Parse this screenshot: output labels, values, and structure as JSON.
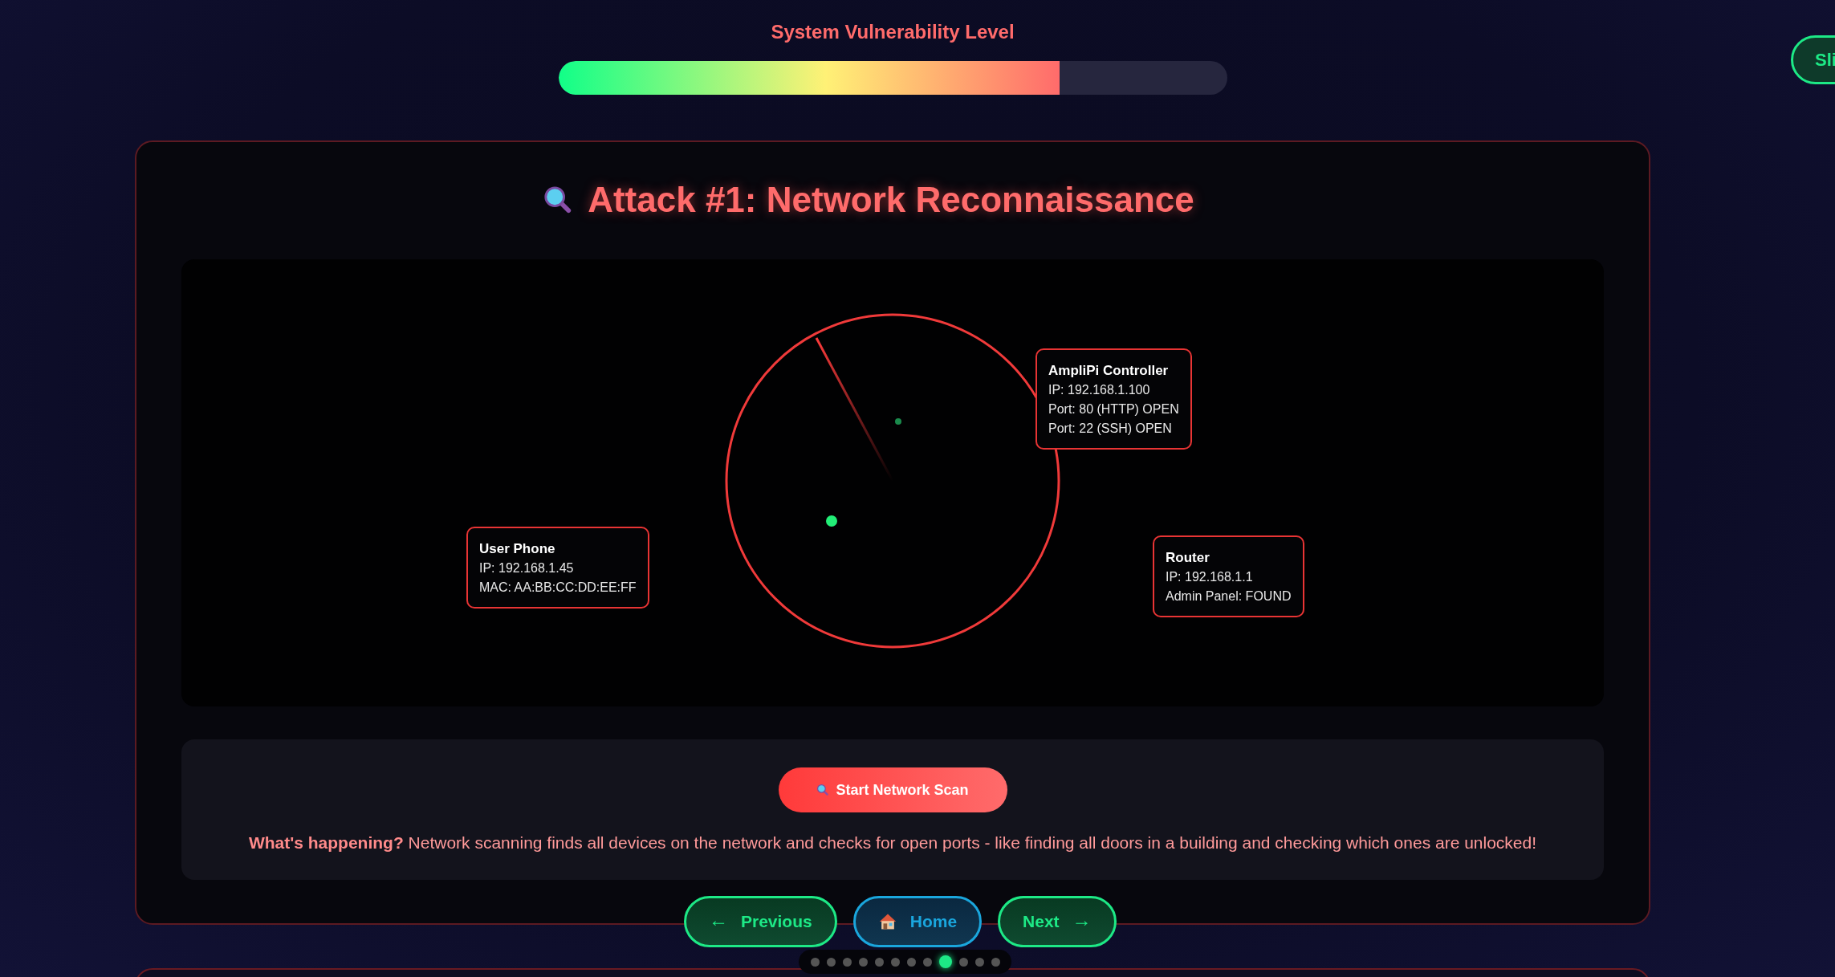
{
  "vulnerability": {
    "title": "System Vulnerability Level",
    "level": 0.75
  },
  "side_button": {
    "label": "Sli"
  },
  "attack": {
    "title": "Attack #1: Network Reconnaissance",
    "devices": [
      {
        "name": "AmpliPi Controller",
        "lines": [
          "IP: 192.168.1.100",
          "Port: 80 (HTTP) OPEN",
          "Port: 22 (SSH) OPEN"
        ]
      },
      {
        "name": "User Phone",
        "lines": [
          "IP: 192.168.1.45",
          "MAC: AA:BB:CC:DD:EE:FF"
        ]
      },
      {
        "name": "Router",
        "lines": [
          "IP: 192.168.1.1",
          "Admin Panel: FOUND"
        ]
      }
    ],
    "scan_button": {
      "label": "Start Network Scan"
    },
    "explanation": "**What's happening?** Network scanning finds all devices on the network and checks for open ports - like finding all doors in a building and checking which ones are unlocked!"
  },
  "nav": [
    {
      "kind": "previous",
      "label": "Previous",
      "arrow": "←"
    },
    {
      "kind": "home",
      "label": "Home"
    },
    {
      "kind": "next",
      "label": "Next",
      "arrow": "→"
    }
  ],
  "slides": [
    {
      "selected": false
    },
    {
      "selected": false
    },
    {
      "selected": false
    },
    {
      "selected": false
    },
    {
      "selected": false
    },
    {
      "selected": false
    },
    {
      "selected": false
    },
    {
      "selected": false
    },
    {
      "selected": true
    },
    {
      "selected": false
    },
    {
      "selected": false
    },
    {
      "selected": false
    }
  ]
}
